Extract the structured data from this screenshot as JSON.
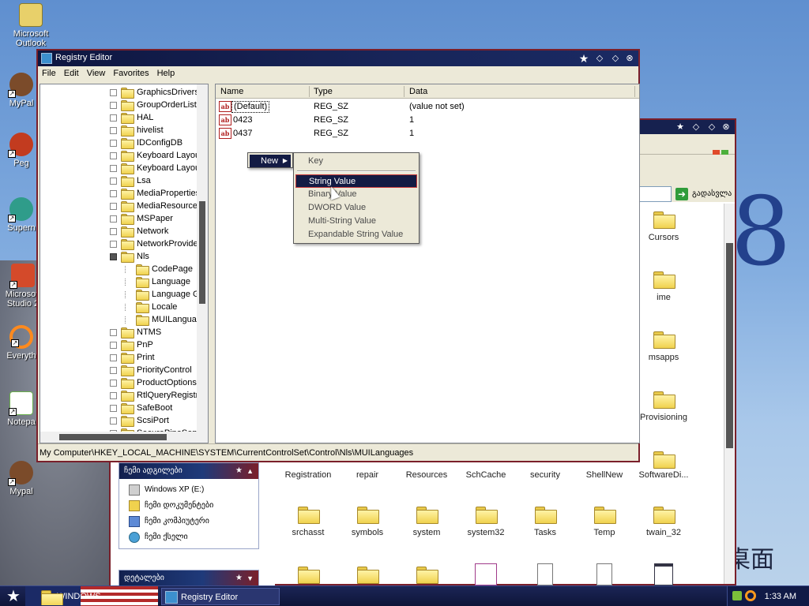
{
  "desktop": {
    "icons": [
      {
        "label": "Microsoft Outlook",
        "color": "#e8d06a"
      },
      {
        "label": "MyPal",
        "color": "#7b4b2a"
      },
      {
        "label": "Peg",
        "color": "#c23b1f"
      },
      {
        "label": "Supern",
        "color": "#2f9c8a"
      },
      {
        "label": "Microsoft Studio 2",
        "color": "#d44a2a"
      },
      {
        "label": "Everyth",
        "color": "#ff8a1e"
      },
      {
        "label": "Notepa",
        "color": "#6ab04c"
      },
      {
        "label": "Mypal",
        "color": "#7b4b2a"
      }
    ],
    "bg_text_8": "8",
    "bg_text_cn": "桌面"
  },
  "regedit": {
    "title": "Registry Editor",
    "menu": [
      "File",
      "Edit",
      "View",
      "Favorites",
      "Help"
    ],
    "tree": [
      {
        "label": "GraphicsDrivers",
        "level": 0
      },
      {
        "label": "GroupOrderList",
        "level": 0
      },
      {
        "label": "HAL",
        "level": 0
      },
      {
        "label": "hivelist",
        "level": 0
      },
      {
        "label": "IDConfigDB",
        "level": 0
      },
      {
        "label": "Keyboard Layout",
        "level": 0
      },
      {
        "label": "Keyboard Layout",
        "level": 0
      },
      {
        "label": "Lsa",
        "level": 0
      },
      {
        "label": "MediaProperties",
        "level": 0
      },
      {
        "label": "MediaResources",
        "level": 0
      },
      {
        "label": "MSPaper",
        "level": 0
      },
      {
        "label": "Network",
        "level": 0
      },
      {
        "label": "NetworkProvider",
        "level": 0
      },
      {
        "label": "Nls",
        "level": 0,
        "expanded": true
      },
      {
        "label": "CodePage",
        "level": 1
      },
      {
        "label": "Language",
        "level": 1
      },
      {
        "label": "Language Gr",
        "level": 1
      },
      {
        "label": "Locale",
        "level": 1
      },
      {
        "label": "MUILanguag",
        "level": 1,
        "selected": true
      },
      {
        "label": "NTMS",
        "level": 0
      },
      {
        "label": "PnP",
        "level": 0
      },
      {
        "label": "Print",
        "level": 0
      },
      {
        "label": "PriorityControl",
        "level": 0
      },
      {
        "label": "ProductOptions",
        "level": 0
      },
      {
        "label": "RtlQueryRegistry",
        "level": 0
      },
      {
        "label": "SafeBoot",
        "level": 0
      },
      {
        "label": "ScsiPort",
        "level": 0
      },
      {
        "label": "SecurePipeServe",
        "level": 0
      }
    ],
    "columns": {
      "name": "Name",
      "type": "Type",
      "data": "Data"
    },
    "values": [
      {
        "name": "(Default)",
        "type": "REG_SZ",
        "data": "(value not set)"
      },
      {
        "name": "0423",
        "type": "REG_SZ",
        "data": "1"
      },
      {
        "name": "0437",
        "type": "REG_SZ",
        "data": "1"
      }
    ],
    "status": "My Computer\\HKEY_LOCAL_MACHINE\\SYSTEM\\CurrentControlSet\\Control\\Nls\\MUILanguages",
    "context_menu": {
      "new_label": "New",
      "submenu": [
        "Key",
        "String Value",
        "Binary Value",
        "DWORD Value",
        "Multi-String Value",
        "Expandable String Value"
      ],
      "selected": "String Value"
    }
  },
  "explorer": {
    "go_label": "გადასვლა",
    "task_pane": {
      "header1": "ჩემი ადგილები",
      "items": [
        "Windows XP (E:)",
        "ჩემი დოკუმენტები",
        "ჩემი კომპიუტერი",
        "ჩემი ქსელი"
      ],
      "header2": "დეტალები"
    },
    "folders_col": [
      "Cursors",
      "ime",
      "msapps",
      "Provisioning"
    ],
    "row1": [
      "Registration",
      "repair",
      "Resources",
      "SchCache",
      "security",
      "ShellNew",
      "SoftwareDi..."
    ],
    "row2": [
      "srchasst",
      "symbols",
      "system",
      "system32",
      "Tasks",
      "Temp",
      "twain_32"
    ]
  },
  "taskbar": {
    "windows_btn": "WINDOWS",
    "reg_btn": "Registry Editor",
    "clock": "1:33 AM"
  },
  "colors": {
    "titlebar": "#16214f",
    "frame": "#7a1f2a",
    "selection": "#131b44",
    "folder": "#f0d24e"
  }
}
